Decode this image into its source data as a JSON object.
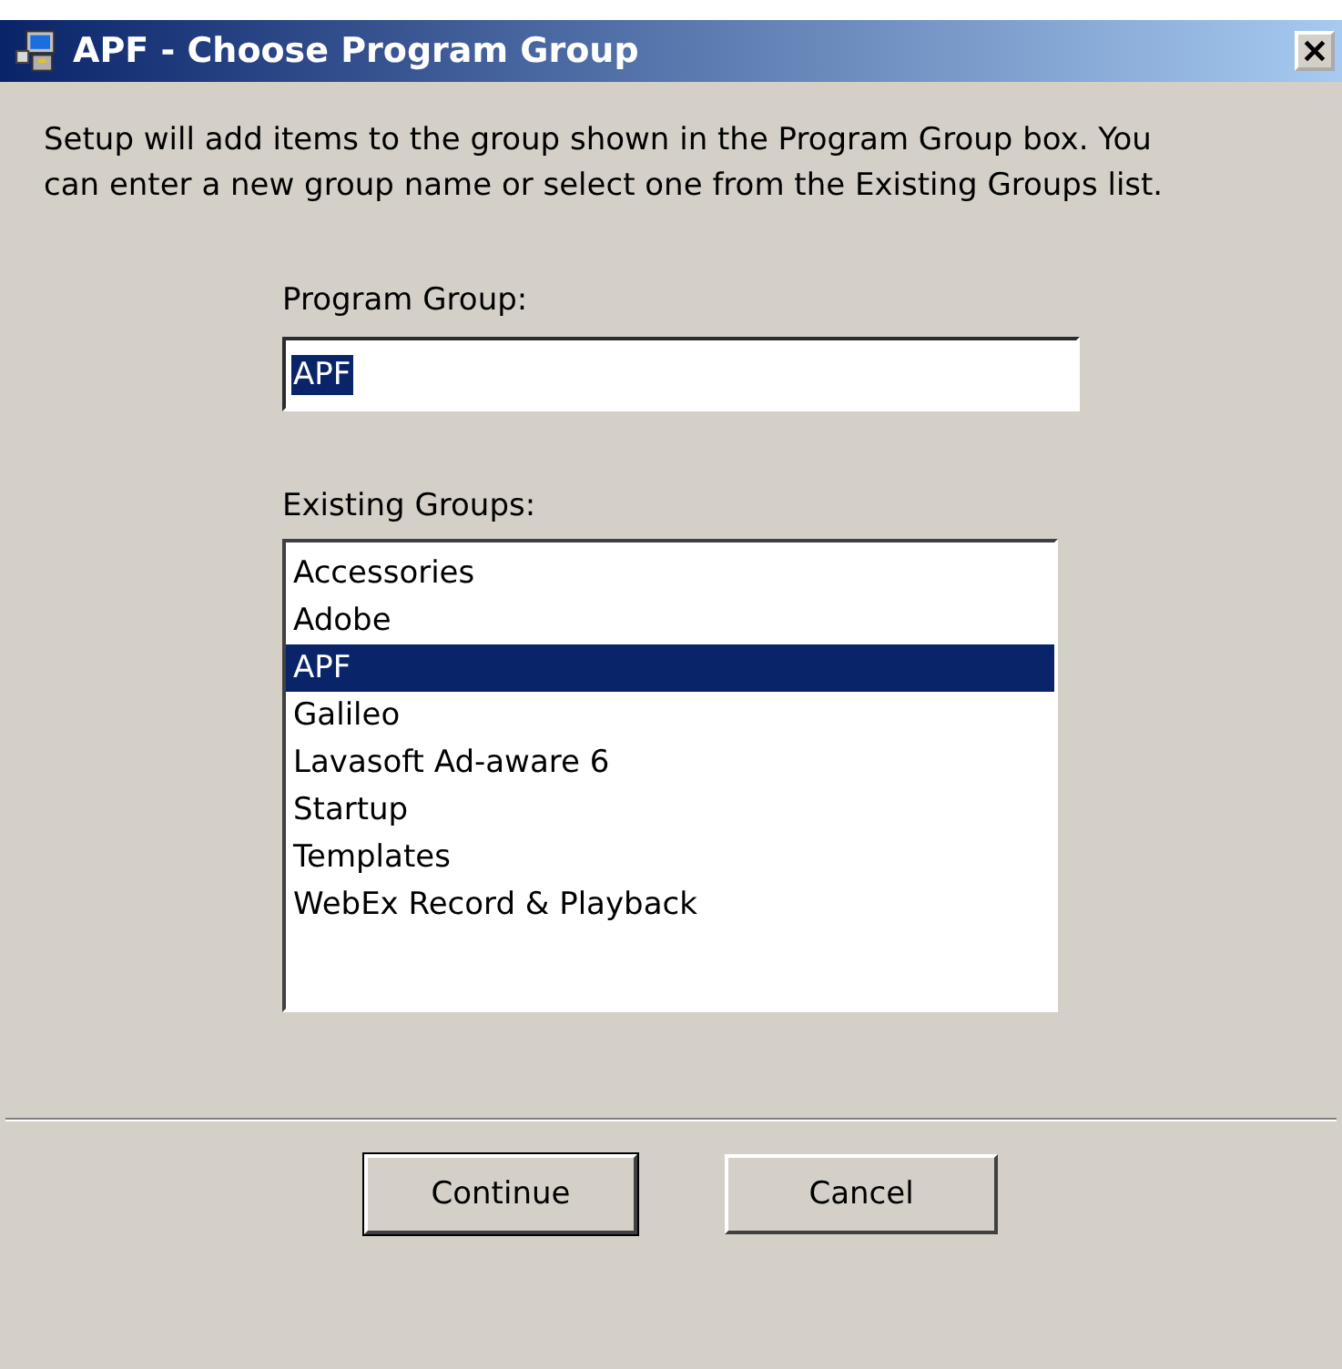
{
  "window": {
    "title": "APF - Choose Program Group"
  },
  "description": "Setup will add items to the group shown in the Program Group box. You can enter a new group name or select one from the Existing Groups list.",
  "program_group": {
    "label": "Program Group:",
    "value": "APF",
    "value_selected": true
  },
  "existing_groups": {
    "label": "Existing Groups:",
    "items": [
      {
        "label": "Accessories",
        "selected": false
      },
      {
        "label": "Adobe",
        "selected": false
      },
      {
        "label": "APF",
        "selected": true
      },
      {
        "label": "Galileo",
        "selected": false
      },
      {
        "label": "Lavasoft Ad-aware 6",
        "selected": false
      },
      {
        "label": "Startup",
        "selected": false
      },
      {
        "label": "Templates",
        "selected": false
      },
      {
        "label": "WebEx Record & Playback",
        "selected": false
      }
    ]
  },
  "buttons": [
    {
      "label": "Continue",
      "default": true
    },
    {
      "label": "Cancel",
      "default": false
    }
  ]
}
